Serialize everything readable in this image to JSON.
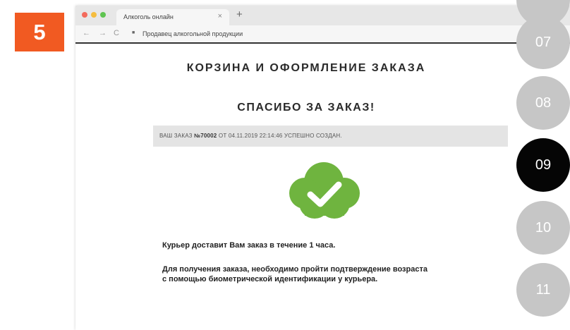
{
  "step_badge": "5",
  "browser": {
    "tab_title": "Алкоголь онлайн",
    "tab_close": "×",
    "new_tab": "+",
    "nav_back": "←",
    "nav_forward": "→",
    "nav_reload": "C",
    "url": "Продавец алкогольной продукции"
  },
  "page": {
    "heading": "КОРЗИНА И ОФОРМЛЕНИЕ ЗАКАЗА",
    "thanks": "СПАСИБО ЗА ЗАКАЗ!",
    "order": {
      "prefix": "ВАШ ЗАКАЗ ",
      "number": "№70002",
      "suffix": " ОТ 04.11.2019 22:14:46 УСПЕШНО СОЗДАН."
    },
    "success_icon": "cloud-check-icon",
    "accent_color": "#6fb43f",
    "courier_message": "Курьер доставит Вам заказ в течение 1 часа.",
    "age_message_line1": "Для получения заказа, необходимо пройти подтверждение возраста",
    "age_message_line2": "с помощью биометрической идентификации у курьера."
  },
  "steps": [
    {
      "label": "07",
      "active": false
    },
    {
      "label": "08",
      "active": false
    },
    {
      "label": "09",
      "active": true
    },
    {
      "label": "10",
      "active": false
    },
    {
      "label": "11",
      "active": false
    }
  ],
  "colors": {
    "badge": "#f15a22",
    "step_inactive": "#c6c6c6",
    "step_active": "#050505"
  }
}
